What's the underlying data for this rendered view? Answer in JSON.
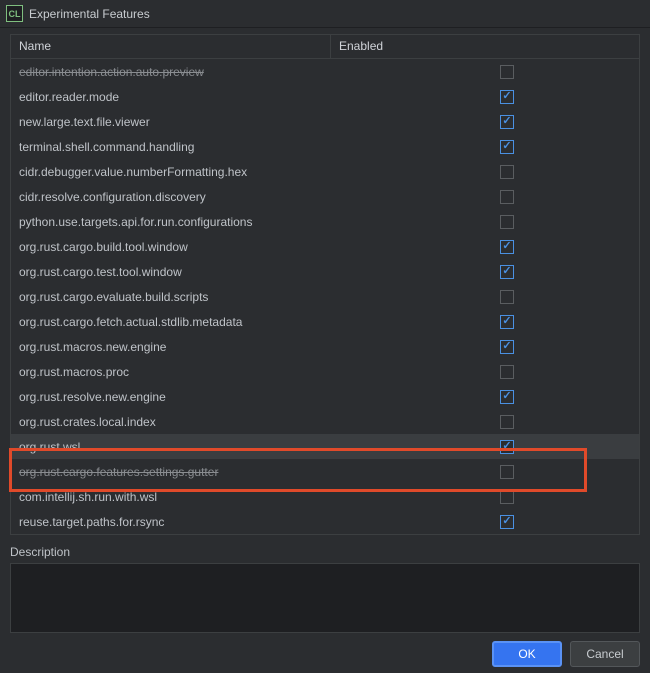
{
  "window": {
    "title": "Experimental Features",
    "icon_label": "CL"
  },
  "table": {
    "headers": {
      "name": "Name",
      "enabled": "Enabled"
    },
    "rows": [
      {
        "name": "editor.intention.action.auto.preview",
        "strike": true,
        "enabled": false
      },
      {
        "name": "editor.reader.mode",
        "strike": false,
        "enabled": true
      },
      {
        "name": "new.large.text.file.viewer",
        "strike": false,
        "enabled": true
      },
      {
        "name": "terminal.shell.command.handling",
        "strike": false,
        "enabled": true
      },
      {
        "name": "cidr.debugger.value.numberFormatting.hex",
        "strike": false,
        "enabled": false
      },
      {
        "name": "cidr.resolve.configuration.discovery",
        "strike": false,
        "enabled": false
      },
      {
        "name": "python.use.targets.api.for.run.configurations",
        "strike": false,
        "enabled": false
      },
      {
        "name": "org.rust.cargo.build.tool.window",
        "strike": false,
        "enabled": true
      },
      {
        "name": "org.rust.cargo.test.tool.window",
        "strike": false,
        "enabled": true
      },
      {
        "name": "org.rust.cargo.evaluate.build.scripts",
        "strike": false,
        "enabled": false
      },
      {
        "name": "org.rust.cargo.fetch.actual.stdlib.metadata",
        "strike": false,
        "enabled": true
      },
      {
        "name": "org.rust.macros.new.engine",
        "strike": false,
        "enabled": true
      },
      {
        "name": "org.rust.macros.proc",
        "strike": false,
        "enabled": false
      },
      {
        "name": "org.rust.resolve.new.engine",
        "strike": false,
        "enabled": true
      },
      {
        "name": "org.rust.crates.local.index",
        "strike": false,
        "enabled": false
      },
      {
        "name": "org.rust.wsl",
        "strike": false,
        "enabled": true,
        "selected": true,
        "highlighted": true
      },
      {
        "name": "org.rust.cargo.features.settings.gutter",
        "strike": true,
        "enabled": false
      },
      {
        "name": "com.intellij.sh.run.with.wsl",
        "strike": false,
        "enabled": false
      },
      {
        "name": "reuse.target.paths.for.rsync",
        "strike": false,
        "enabled": true
      }
    ]
  },
  "description": {
    "label": "Description",
    "text": ""
  },
  "buttons": {
    "ok": "OK",
    "cancel": "Cancel"
  },
  "colors": {
    "accent": "#3574f0",
    "highlight": "#e04a2a"
  }
}
